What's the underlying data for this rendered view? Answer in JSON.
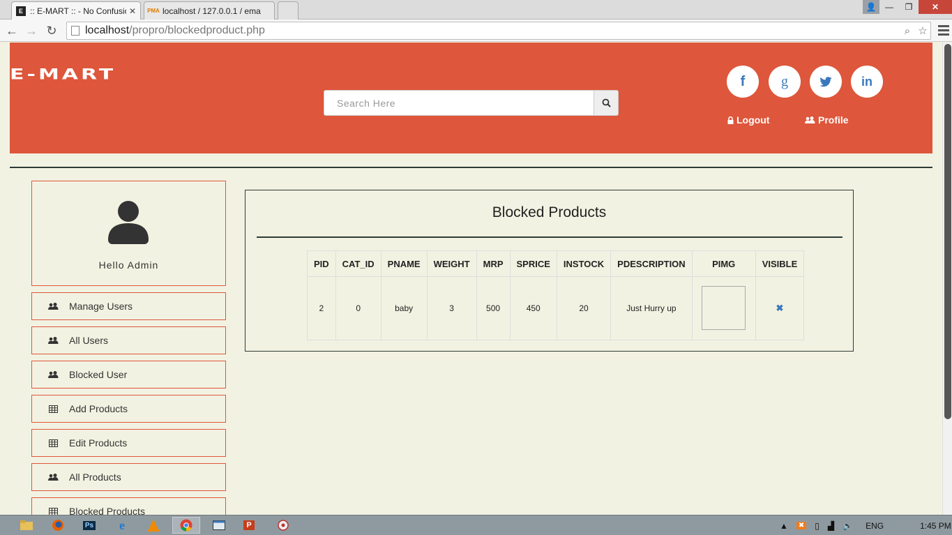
{
  "browser": {
    "tabs": [
      {
        "title": ":: E-MART :: - No Confusio",
        "favicon": "emart-icon"
      },
      {
        "title": "localhost / 127.0.0.1 / ema",
        "favicon": "phpmyadmin-icon"
      }
    ],
    "url_host": "localhost",
    "url_path": "/propro/blockedproduct.php"
  },
  "header": {
    "logo_text": "E-MART",
    "search_placeholder": "Search Here",
    "social": [
      {
        "name": "facebook-icon",
        "glyph": "f"
      },
      {
        "name": "google-icon",
        "glyph": "g"
      },
      {
        "name": "twitter-icon",
        "glyph": "t"
      },
      {
        "name": "linkedin-icon",
        "glyph": "in"
      }
    ],
    "logout_label": "Logout",
    "profile_label": "Profile"
  },
  "sidebar": {
    "greeting": "Hello Admin",
    "items": [
      {
        "label": "Manage Users",
        "icon": "users-icon"
      },
      {
        "label": "All Users",
        "icon": "users-icon"
      },
      {
        "label": "Blocked User",
        "icon": "users-icon"
      },
      {
        "label": "Add Products",
        "icon": "table-icon"
      },
      {
        "label": "Edit Products",
        "icon": "table-icon"
      },
      {
        "label": "All Products",
        "icon": "users-icon"
      },
      {
        "label": "Blocked Products",
        "icon": "table-icon"
      }
    ]
  },
  "main": {
    "title": "Blocked Products",
    "columns": [
      "PID",
      "CAT_ID",
      "PNAME",
      "WEIGHT",
      "MRP",
      "SPRICE",
      "INSTOCK",
      "PDESCRIPTION",
      "PIMG",
      "VISIBLE"
    ],
    "rows": [
      {
        "pid": "2",
        "cat_id": "0",
        "pname": "baby",
        "weight": "3",
        "mrp": "500",
        "sprice": "450",
        "instock": "20",
        "pdescription": "Just Hurry up",
        "pimg": "",
        "visible": "✖"
      }
    ]
  },
  "taskbar": {
    "language": "ENG",
    "time": "1:45 PM"
  },
  "colors": {
    "brand": "#de563b",
    "page_bg": "#f2f2e2",
    "link_blue": "#3a78ba"
  }
}
